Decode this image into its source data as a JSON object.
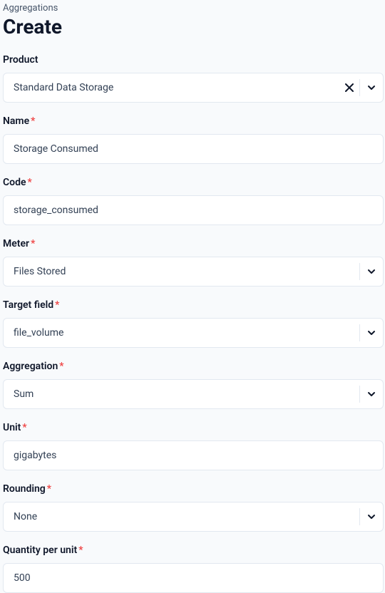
{
  "breadcrumb": "Aggregations",
  "title": "Create",
  "fields": {
    "product": {
      "label": "Product",
      "value": "Standard Data Storage"
    },
    "name": {
      "label": "Name",
      "value": "Storage Consumed"
    },
    "code": {
      "label": "Code",
      "value": "storage_consumed"
    },
    "meter": {
      "label": "Meter",
      "value": "Files Stored"
    },
    "targetField": {
      "label": "Target field",
      "value": "file_volume"
    },
    "aggregation": {
      "label": "Aggregation",
      "value": "Sum"
    },
    "unit": {
      "label": "Unit",
      "value": "gigabytes"
    },
    "rounding": {
      "label": "Rounding",
      "value": "None"
    },
    "qtyPerUnit": {
      "label": "Quantity per unit",
      "value": "500"
    }
  }
}
